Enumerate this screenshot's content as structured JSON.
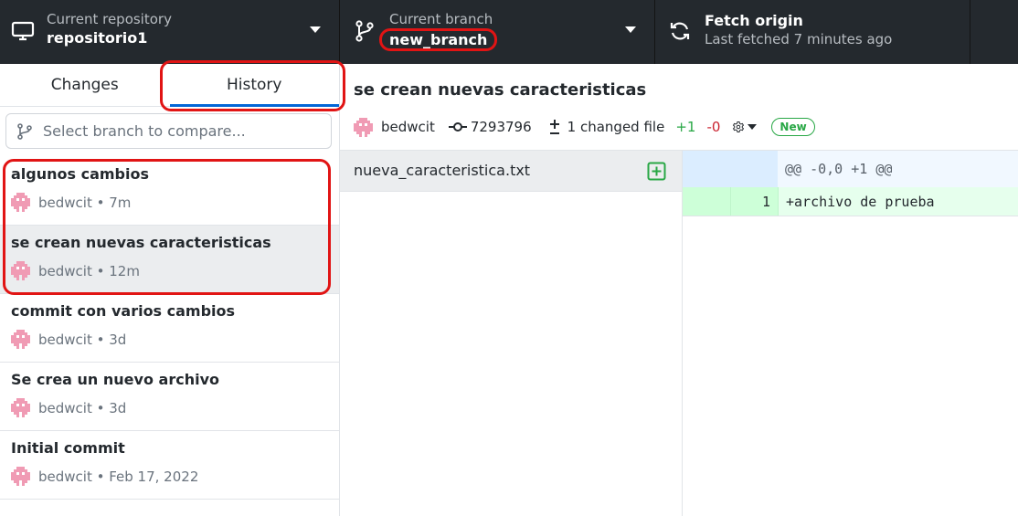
{
  "toolbar": {
    "repository": {
      "label": "Current repository",
      "value": "repositorio1",
      "icon": "monitor-icon"
    },
    "branch": {
      "label": "Current branch",
      "value": "new_branch",
      "icon": "git-branch-icon"
    },
    "fetch": {
      "label": "Fetch origin",
      "subtitle": "Last fetched 7 minutes ago",
      "icon": "sync-icon"
    }
  },
  "sidebar": {
    "tabs": [
      {
        "label": "Changes",
        "active": false
      },
      {
        "label": "History",
        "active": true
      }
    ],
    "branch_compare": {
      "placeholder": "Select branch to compare..."
    },
    "commits": [
      {
        "title": "algunos cambios",
        "author": "bedwcit",
        "age": "7m",
        "selected": false
      },
      {
        "title": "se crean nuevas caracteristicas",
        "author": "bedwcit",
        "age": "12m",
        "selected": true
      },
      {
        "title": "commit con varios cambios",
        "author": "bedwcit",
        "age": "3d",
        "selected": false
      },
      {
        "title": "Se crea un nuevo archivo",
        "author": "bedwcit",
        "age": "3d",
        "selected": false
      },
      {
        "title": "Initial commit",
        "author": "bedwcit",
        "age": "Feb 17, 2022",
        "selected": false
      }
    ]
  },
  "commit": {
    "summary": "se crean nuevas caracteristicas",
    "author": "bedwcit",
    "sha": "7293796",
    "changed_files": "1 changed file",
    "additions": "+1",
    "deletions": "-0",
    "badge": "New"
  },
  "files": [
    {
      "name": "nueva_caracteristica.txt",
      "status": "added"
    }
  ],
  "diff": {
    "hunk_header": "@@ -0,0 +1 @@",
    "lines": [
      {
        "new_line": "1",
        "text": "+archivo de prueba"
      }
    ]
  },
  "colors": {
    "toolbar_bg": "#24292e",
    "accent": "#0366d6",
    "annotation": "#e11414",
    "added": "#28a745",
    "deleted": "#cb2431"
  }
}
